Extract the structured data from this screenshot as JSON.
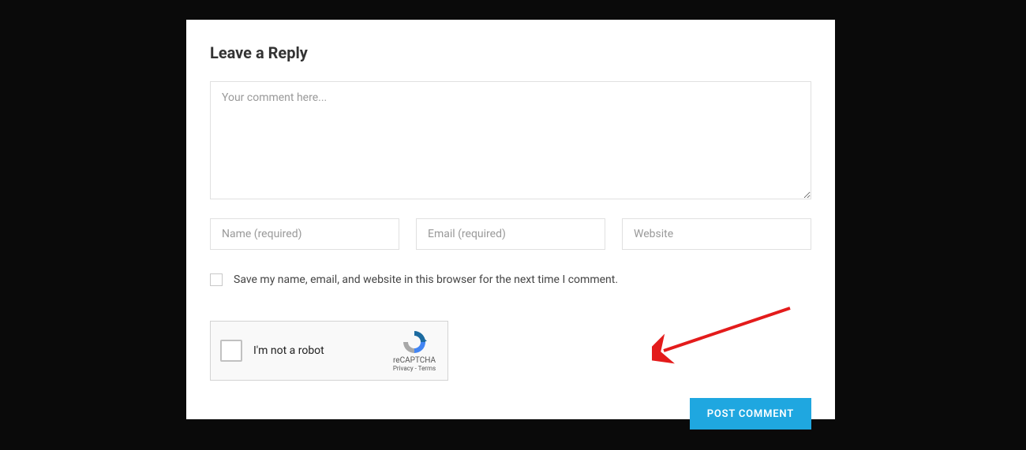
{
  "form": {
    "title": "Leave a Reply",
    "comment_placeholder": "Your comment here...",
    "name_placeholder": "Name (required)",
    "email_placeholder": "Email (required)",
    "website_placeholder": "Website",
    "save_label": "Save my name, email, and website in this browser for the next time I comment.",
    "submit_label": "POST COMMENT"
  },
  "recaptcha": {
    "label": "I'm not a robot",
    "brand": "reCAPTCHA",
    "links": "Privacy - Terms"
  }
}
